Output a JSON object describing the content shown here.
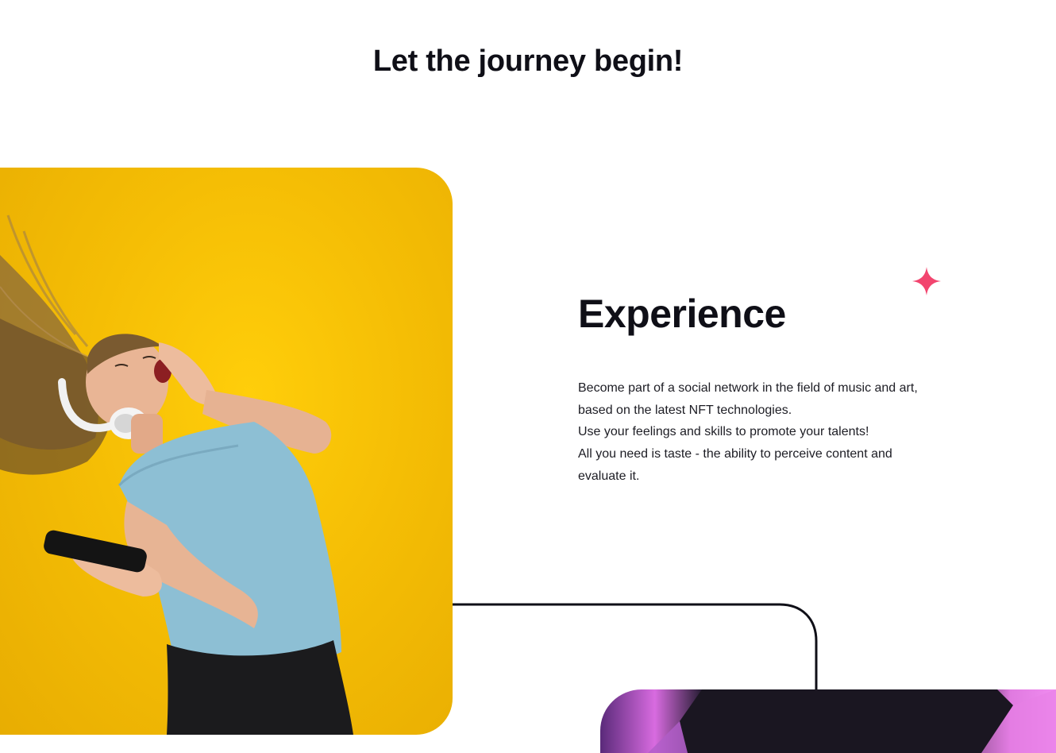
{
  "page": {
    "title": "Let the journey begin!"
  },
  "experience": {
    "heading": "Experience",
    "lines": [
      "Become part of a social network in the field of music and art, based on the latest NFT technologies.",
      "Use your feelings and skills to promote your talents!",
      "All you need is taste - the ability to perceive content and evaluate it."
    ]
  },
  "icons": {
    "sparkle": "sparkle-icon"
  },
  "colors": {
    "text": "#0f0f17",
    "accent": "#f2456f",
    "photo_background": "#f5be05",
    "nft_glow": "#e07ae0"
  }
}
